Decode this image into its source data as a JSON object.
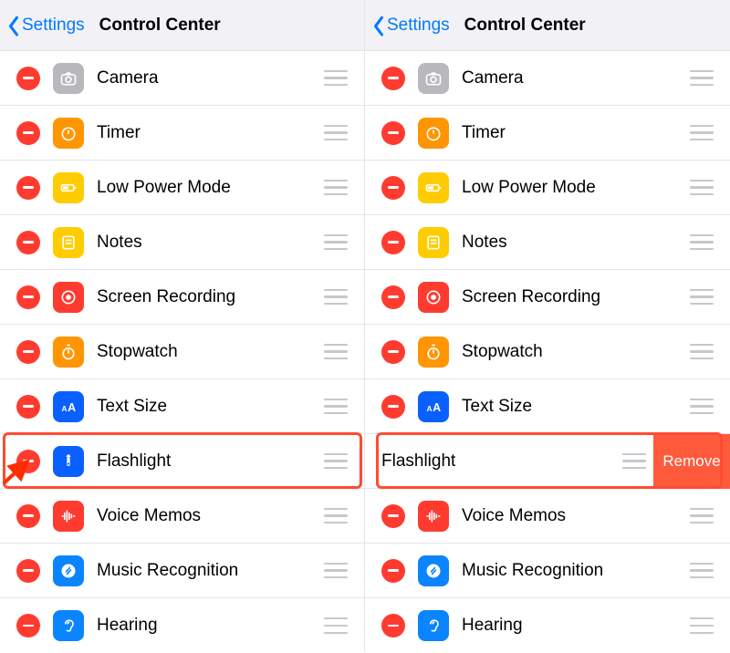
{
  "nav": {
    "back_label": "Settings",
    "title": "Control Center"
  },
  "remove_label": "Remove",
  "icons": {
    "camera": {
      "cls": "bg-gray",
      "glyph": "camera"
    },
    "timer": {
      "cls": "bg-orange",
      "glyph": "timer"
    },
    "lowpower": {
      "cls": "bg-yellow",
      "glyph": "battery"
    },
    "notes": {
      "cls": "bg-yellow",
      "glyph": "notes"
    },
    "screenrec": {
      "cls": "bg-red",
      "glyph": "record"
    },
    "stopwatch": {
      "cls": "bg-orange",
      "glyph": "stopwatch"
    },
    "textsize": {
      "cls": "bg-blue",
      "glyph": "textsize"
    },
    "flash": {
      "cls": "bg-blue",
      "glyph": "flash"
    },
    "voicememo": {
      "cls": "bg-red",
      "glyph": "wave"
    },
    "musicrec": {
      "cls": "bg-blue2",
      "glyph": "shazam"
    },
    "hearing": {
      "cls": "bg-blue2",
      "glyph": "ear"
    }
  },
  "left": {
    "items": [
      {
        "id": "camera",
        "label": "Camera"
      },
      {
        "id": "timer",
        "label": "Timer"
      },
      {
        "id": "lowpower",
        "label": "Low Power Mode"
      },
      {
        "id": "notes",
        "label": "Notes"
      },
      {
        "id": "screenrec",
        "label": "Screen Recording"
      },
      {
        "id": "stopwatch",
        "label": "Stopwatch"
      },
      {
        "id": "textsize",
        "label": "Text Size"
      },
      {
        "id": "flash",
        "label": "Flashlight",
        "highlighted": true,
        "arrow": true
      },
      {
        "id": "voicememo",
        "label": "Voice Memos"
      },
      {
        "id": "musicrec",
        "label": "Music Recognition"
      },
      {
        "id": "hearing",
        "label": "Hearing"
      }
    ]
  },
  "right": {
    "items": [
      {
        "id": "camera",
        "label": "Camera"
      },
      {
        "id": "timer",
        "label": "Timer"
      },
      {
        "id": "lowpower",
        "label": "Low Power Mode"
      },
      {
        "id": "notes",
        "label": "Notes"
      },
      {
        "id": "screenrec",
        "label": "Screen Recording"
      },
      {
        "id": "stopwatch",
        "label": "Stopwatch"
      },
      {
        "id": "textsize",
        "label": "Text Size"
      },
      {
        "id": "flash",
        "label": "Flashlight",
        "highlighted": true,
        "swiped": true
      },
      {
        "id": "voicememo",
        "label": "Voice Memos"
      },
      {
        "id": "musicrec",
        "label": "Music Recognition"
      },
      {
        "id": "hearing",
        "label": "Hearing"
      }
    ]
  }
}
